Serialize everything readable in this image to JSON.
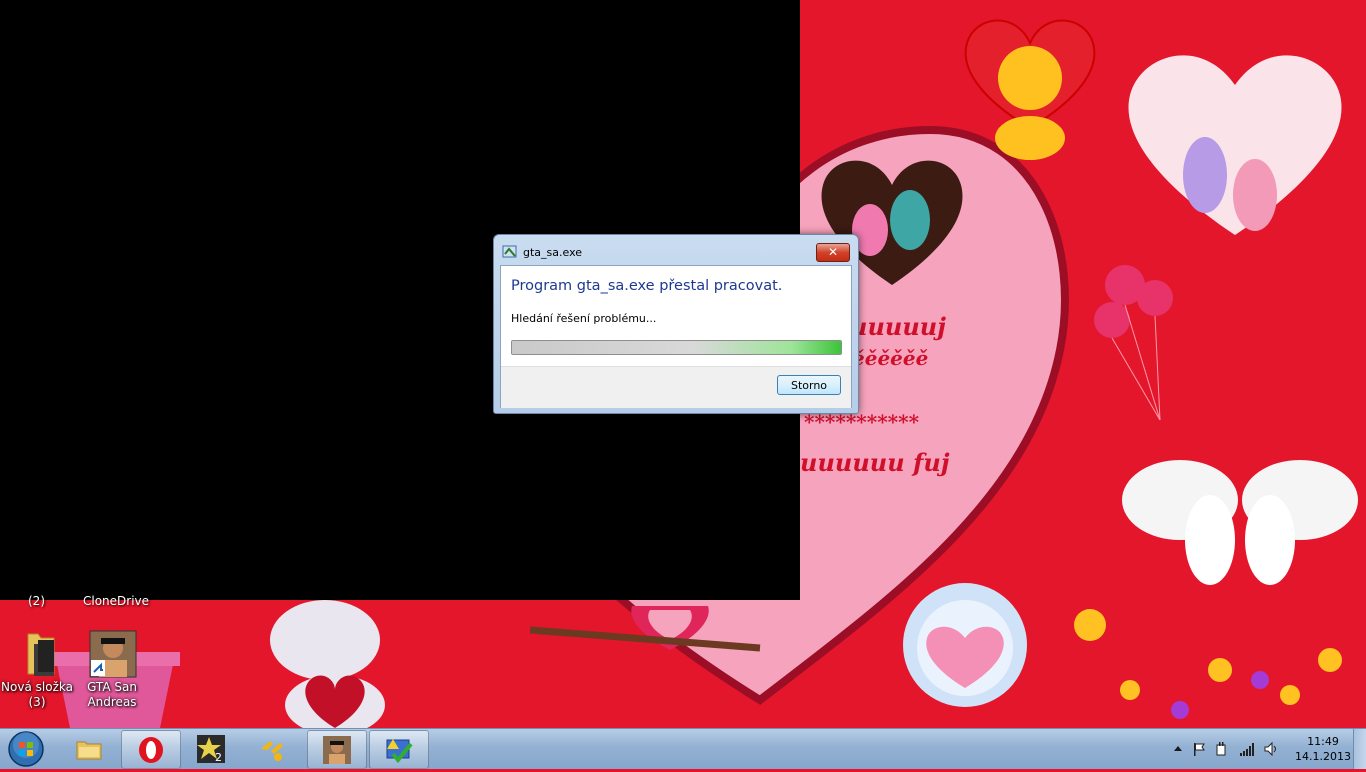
{
  "wallpaper": {
    "text_lines": [
      "uuuuuj",
      "ěěěěěě",
      "***********",
      "uuuuuu fuj"
    ],
    "clipped_labels": [
      "(2)",
      "CloneDrive"
    ]
  },
  "desktop_icons": [
    {
      "label": "Nová složka (3)",
      "icon": "folder-icon"
    },
    {
      "label": "GTA San Andreas",
      "icon": "gta-shortcut-icon"
    }
  ],
  "dialog": {
    "title": "gta_sa.exe",
    "heading": "Program gta_sa.exe přestal pracovat.",
    "message": "Hledání řešení problému...",
    "progress": 1.0,
    "cancel_label": "Storno",
    "close_glyph": "✕"
  },
  "taskbar": {
    "pinned": [
      {
        "name": "explorer",
        "icon": "folder-icon"
      },
      {
        "name": "opera",
        "icon": "opera-icon"
      },
      {
        "name": "star-2",
        "icon": "star-2-icon"
      },
      {
        "name": "game-tool",
        "icon": "gamepad-icon"
      },
      {
        "name": "gta-sa",
        "icon": "gta-icon"
      },
      {
        "name": "checker",
        "icon": "check-icon"
      }
    ],
    "tray_icons": [
      "show-hidden-icon",
      "action-center-flag-icon",
      "power-icon",
      "network-signal-icon",
      "volume-icon"
    ]
  },
  "clock": {
    "time": "11:49",
    "date": "14.1.2013"
  },
  "colors": {
    "wallpaper_red": "#e3162b",
    "heart_pink": "#f6a3bd",
    "dialog_heading": "#1d3a91",
    "progress_green": "#3cc43a"
  }
}
